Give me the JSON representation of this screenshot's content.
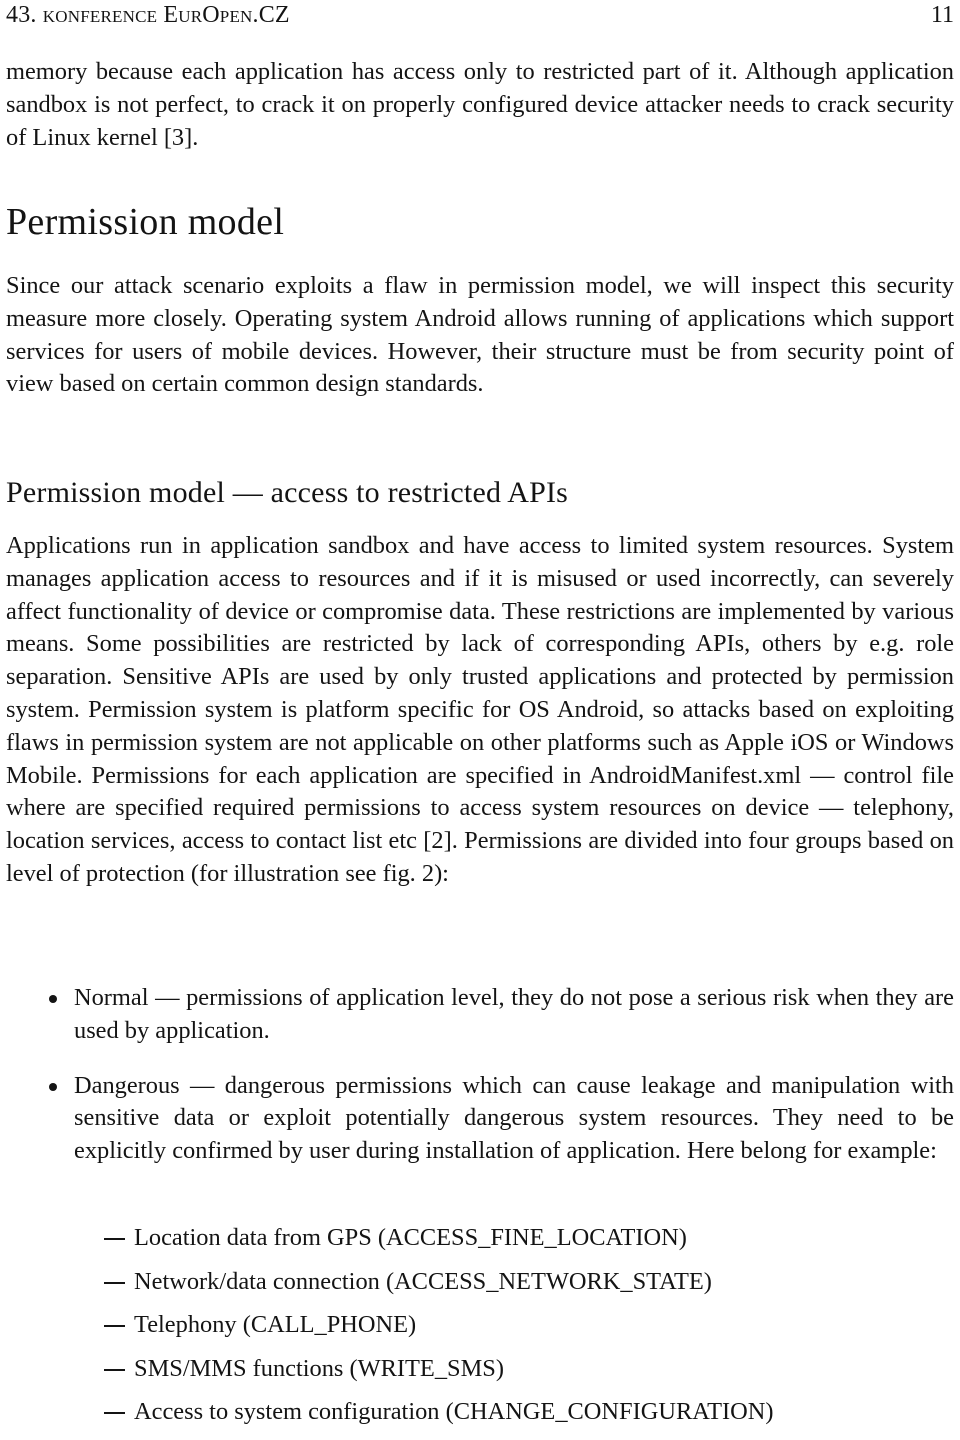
{
  "header": {
    "conference": "43. konference EurOpen.CZ",
    "page_number": "11"
  },
  "paragraphs": {
    "intro": "memory because each application has access only to restricted part of it. Al­though application sandbox is not perfect, to crack it on properly configured device attacker needs to crack security of Linux kernel [3]."
  },
  "sections": {
    "permission_model": {
      "title": "Permission model",
      "body": "Since our attack scenario exploits a flaw in permission model, we will inspect this security measure more closely. Operating system Android allows running of applications which support services for users of mobile devices. However, their structure must be from security point of view based on certain common design standards."
    },
    "restricted_apis": {
      "title": "Permission model — access to restricted APIs",
      "body": "Applications run in application sandbox and have access to limited system re­sources. System manages application access to resources and if it is misused or used incorrectly, can severely affect functionality of device or compromise data. These restrictions are implemented by various means. Some possibilities are re­stricted by lack of corresponding APIs, others by e.g. role separation. Sensitive APIs are used by only trusted applications and protected by permission system. Permission system is platform specific for OS Android, so attacks based on ex­ploiting flaws in permission system are not applicable on other platforms such as Apple iOS or Windows Mobile. Permissions for each application are specified in AndroidManifest.xml — control file where are specified required permissions to access system resources on device — telephony, location services, access to contact list etc [2]. Permissions are divided into four groups based on level of protection (for illustration see fig. 2):"
    }
  },
  "permission_groups": [
    {
      "text": "Normal — permissions of application level, they do not pose a serious risk when they are used by application."
    },
    {
      "text": "Dangerous — dangerous permissions which can cause leakage and ma­nipulation with sensitive data or exploit potentially dangerous system re­sources. They need to be explicitly confirmed by user during installation of application. Here belong for example:"
    }
  ],
  "dangerous_examples": [
    {
      "text": "Location data from GPS (ACCESS_FINE_LOCATION)"
    },
    {
      "text": "Network/data connection (ACCESS_NETWORK_STATE)"
    },
    {
      "text": "Telephony (CALL_PHONE)"
    },
    {
      "text": "SMS/MMS functions (WRITE_SMS)"
    },
    {
      "text": "Access to system configuration (CHANGE_CONFIGURATION)"
    }
  ]
}
